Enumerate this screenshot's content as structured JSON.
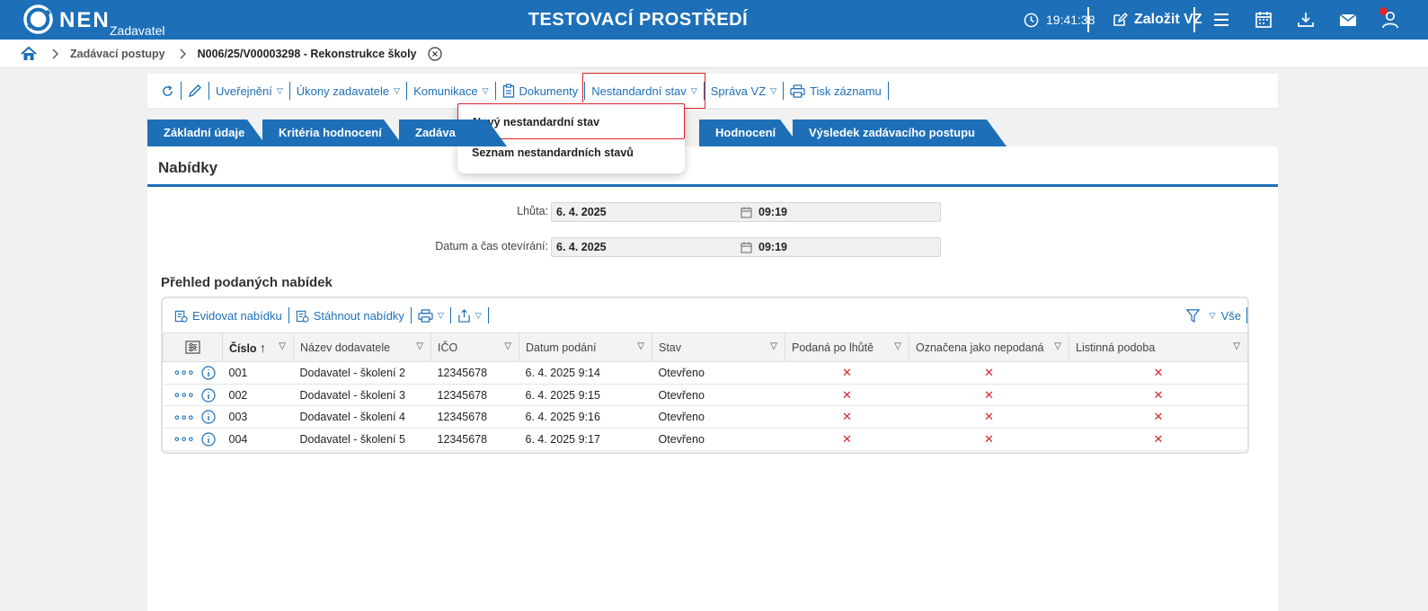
{
  "topbar": {
    "logo_text": "NEN",
    "role": "Zadavatel",
    "environment": "TESTOVACÍ PROSTŘEDÍ",
    "clock": "19:41:38",
    "create_label": "Založit VZ",
    "color": "#1d6fb8"
  },
  "breadcrumb": {
    "items": [
      "Zadávací postupy"
    ],
    "current": "N006/25/V00003298 - Rekonstrukce školy"
  },
  "actions": {
    "publication": "Uveřejnění",
    "acts": "Úkony zadavatele",
    "communication": "Komunikace",
    "documents": "Dokumenty",
    "nonstandard": "Nestandardní stav",
    "management": "Správa VZ",
    "print": "Tisk záznamu"
  },
  "dropdown": {
    "items": [
      "Nový nestandardní stav",
      "Seznam nestandardních stavů"
    ]
  },
  "tabs": [
    "Základní údaje",
    "Kritéria hodnocení",
    "Zadáva",
    "Hodnocení",
    "Výsledek zadávacího postupu"
  ],
  "section": {
    "title": "Nabídky",
    "deadline_label": "Lhůta:",
    "deadline_date": "6. 4. 2025",
    "deadline_time": "09:19",
    "opening_label": "Datum a čas otevírání:",
    "opening_date": "6. 4. 2025",
    "opening_time": "09:19"
  },
  "offers": {
    "title": "Přehled podaných nabídek",
    "toolbar": {
      "register": "Evidovat nabídku",
      "download": "Stáhnout nabídky",
      "filter_all": "Vše"
    },
    "columns": [
      "Číslo",
      "Název dodavatele",
      "IČO",
      "Datum podání",
      "Stav",
      "Podaná po lhůtě",
      "Označena jako nepodaná",
      "Listinná podoba"
    ],
    "rows": [
      {
        "number": "001",
        "supplier": "Dodavatel - školení 2",
        "ico": "12345678",
        "submitted": "6. 4. 2025 9:14",
        "status": "Otevřeno",
        "late": "✕",
        "not_submitted": "✕",
        "paper": "✕"
      },
      {
        "number": "002",
        "supplier": "Dodavatel - školení 3",
        "ico": "12345678",
        "submitted": "6. 4. 2025 9:15",
        "status": "Otevřeno",
        "late": "✕",
        "not_submitted": "✕",
        "paper": "✕"
      },
      {
        "number": "003",
        "supplier": "Dodavatel - školení 4",
        "ico": "12345678",
        "submitted": "6. 4. 2025 9:16",
        "status": "Otevřeno",
        "late": "✕",
        "not_submitted": "✕",
        "paper": "✕"
      },
      {
        "number": "004",
        "supplier": "Dodavatel - školení 5",
        "ico": "12345678",
        "submitted": "6. 4. 2025 9:17",
        "status": "Otevřeno",
        "late": "✕",
        "not_submitted": "✕",
        "paper": "✕"
      }
    ]
  }
}
